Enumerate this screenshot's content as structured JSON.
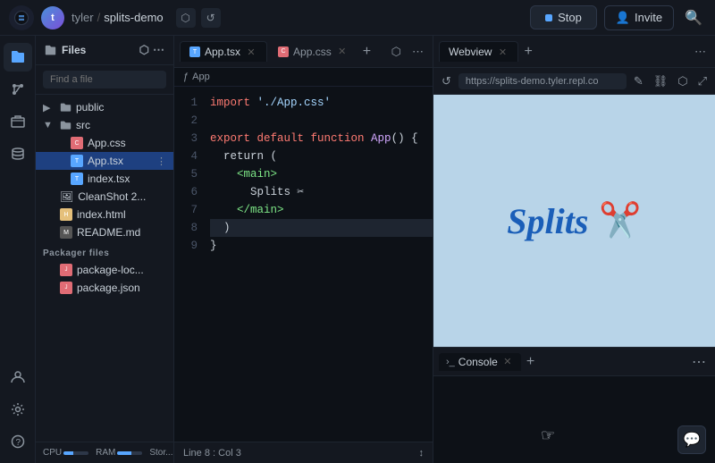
{
  "topbar": {
    "user": "tyler",
    "repl_name": "splits-demo",
    "stop_label": "Stop",
    "invite_label": "Invite"
  },
  "sidebar": {
    "sections": [
      "files",
      "git",
      "packages",
      "database",
      "user",
      "settings",
      "help"
    ]
  },
  "file_panel": {
    "title": "Files",
    "search_placeholder": "Find a file",
    "items": [
      {
        "name": "public",
        "type": "folder",
        "indent": 0
      },
      {
        "name": "src",
        "type": "folder",
        "indent": 0
      },
      {
        "name": "App.css",
        "type": "css",
        "indent": 1
      },
      {
        "name": "App.tsx",
        "type": "tsx",
        "indent": 1,
        "active": true
      },
      {
        "name": "index.tsx",
        "type": "tsx",
        "indent": 1
      },
      {
        "name": "CleanShot 2...",
        "type": "img",
        "indent": 0
      },
      {
        "name": "index.html",
        "type": "html",
        "indent": 0
      },
      {
        "name": "README.md",
        "type": "md",
        "indent": 0
      }
    ],
    "packager_section": "Packager files",
    "packager_items": [
      {
        "name": "package-loc...",
        "type": "json"
      },
      {
        "name": "package.json",
        "type": "json"
      }
    ]
  },
  "editor": {
    "tabs": [
      {
        "name": "App.tsx",
        "active": true
      },
      {
        "name": "App.css",
        "active": false
      }
    ],
    "code_lines": [
      {
        "num": 1,
        "content": "import './App.css'"
      },
      {
        "num": 2,
        "content": ""
      },
      {
        "num": 3,
        "content": "export default function App() {",
        "arrow": true
      },
      {
        "num": 4,
        "content": "  return ("
      },
      {
        "num": 5,
        "content": "    <main>"
      },
      {
        "num": 6,
        "content": "      Splits ✂",
        "active": true
      },
      {
        "num": 7,
        "content": "    </main>"
      },
      {
        "num": 8,
        "content": "  )",
        "active": true
      },
      {
        "num": 9,
        "content": "}"
      }
    ],
    "status": "Line 8 : Col 3"
  },
  "webview": {
    "tab_label": "Webview",
    "url": "https://splits-demo.tyler.repl.co",
    "app_text": "Splits",
    "scissors": "✂️"
  },
  "console": {
    "tab_label": "Console",
    "cursor_visible": true
  },
  "status_bar": {
    "cpu_label": "CPU",
    "ram_label": "RAM",
    "stor_label": "Stor..."
  }
}
